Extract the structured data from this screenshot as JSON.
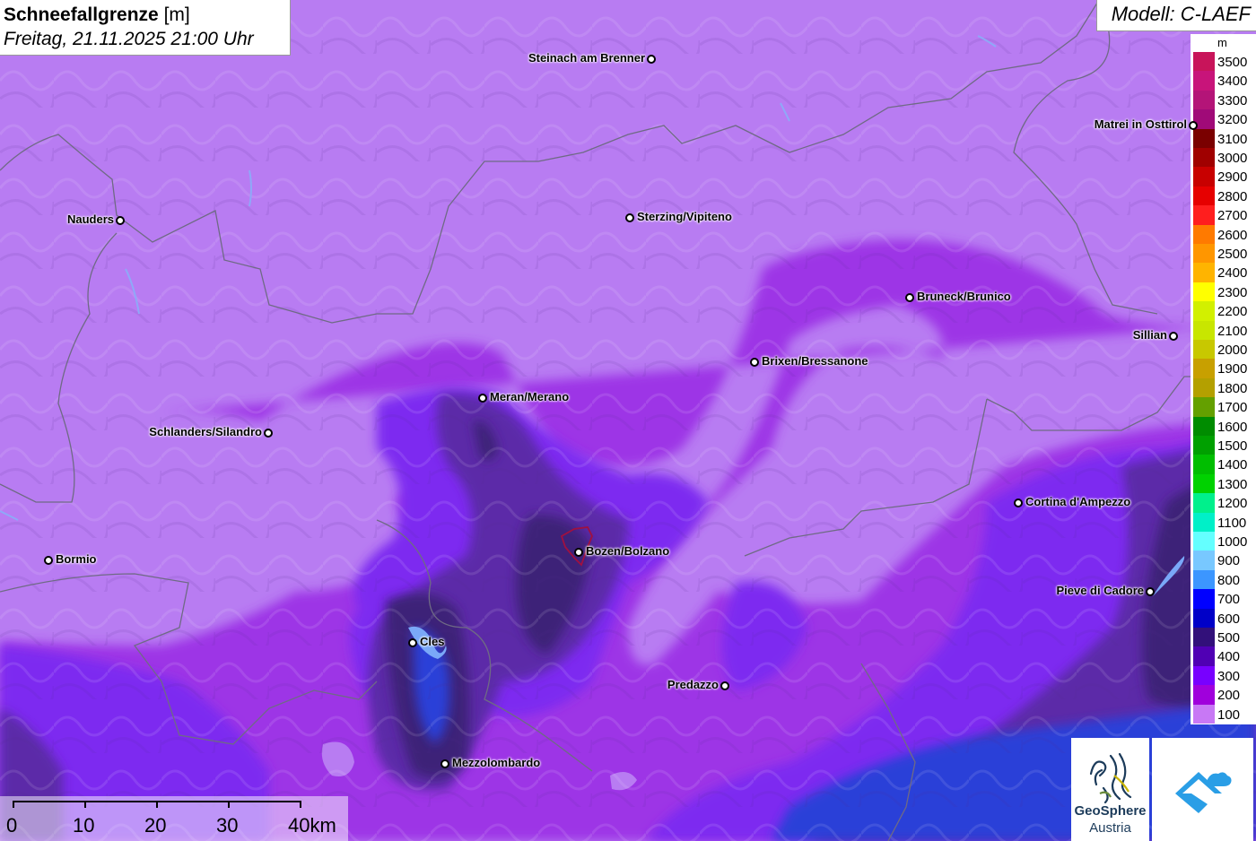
{
  "title": {
    "main_bold": "Schneefallgrenze",
    "main_unit": " [m]",
    "subtitle": "Freitag, 21.11.2025 21:00 Uhr"
  },
  "model_label": "Modell: C-LAEF",
  "legend": {
    "unit": "m",
    "entries": [
      {
        "label": "3500",
        "color": "#c8145a"
      },
      {
        "label": "3400",
        "color": "#c8147a"
      },
      {
        "label": "3300",
        "color": "#b41478"
      },
      {
        "label": "3200",
        "color": "#a00a78"
      },
      {
        "label": "3100",
        "color": "#7a0000"
      },
      {
        "label": "3000",
        "color": "#a00000"
      },
      {
        "label": "2900",
        "color": "#c80000"
      },
      {
        "label": "2800",
        "color": "#e60000"
      },
      {
        "label": "2700",
        "color": "#ff1e1e"
      },
      {
        "label": "2600",
        "color": "#ff7a00"
      },
      {
        "label": "2500",
        "color": "#ff9600"
      },
      {
        "label": "2400",
        "color": "#ffb400"
      },
      {
        "label": "2300",
        "color": "#ffff00"
      },
      {
        "label": "2200",
        "color": "#d2f000"
      },
      {
        "label": "2100",
        "color": "#c8e600"
      },
      {
        "label": "2000",
        "color": "#c8c800"
      },
      {
        "label": "1900",
        "color": "#c8a000"
      },
      {
        "label": "1800",
        "color": "#b4a000"
      },
      {
        "label": "1700",
        "color": "#64a000"
      },
      {
        "label": "1600",
        "color": "#008c00"
      },
      {
        "label": "1500",
        "color": "#00a000"
      },
      {
        "label": "1400",
        "color": "#00be00"
      },
      {
        "label": "1300",
        "color": "#00d200"
      },
      {
        "label": "1200",
        "color": "#00f08c"
      },
      {
        "label": "1100",
        "color": "#00f0c8"
      },
      {
        "label": "1000",
        "color": "#64ffff"
      },
      {
        "label": "900",
        "color": "#78c8ff"
      },
      {
        "label": "800",
        "color": "#3c96ff"
      },
      {
        "label": "700",
        "color": "#0000ff"
      },
      {
        "label": "600",
        "color": "#0000c8"
      },
      {
        "label": "500",
        "color": "#32107a"
      },
      {
        "label": "400",
        "color": "#5000b4"
      },
      {
        "label": "300",
        "color": "#7800ff"
      },
      {
        "label": "200",
        "color": "#a000dc"
      },
      {
        "label": "100",
        "color": "#c878f5"
      }
    ]
  },
  "cities": [
    {
      "name": "Steinach am Brenner",
      "label_side": "left"
    },
    {
      "name": "Matrei in Osttirol",
      "label_side": "left"
    },
    {
      "name": "Nauders",
      "label_side": "left"
    },
    {
      "name": "Sterzing/Vipiteno",
      "label_side": "right"
    },
    {
      "name": "Bruneck/Brunico",
      "label_side": "right"
    },
    {
      "name": "Sillian",
      "label_side": "left"
    },
    {
      "name": "Brixen/Bressanone",
      "label_side": "right"
    },
    {
      "name": "Meran/Merano",
      "label_side": "right"
    },
    {
      "name": "Schlanders/Silandro",
      "label_side": "left"
    },
    {
      "name": "Cortina d'Ampezzo",
      "label_side": "right"
    },
    {
      "name": "Bormio",
      "label_side": "right"
    },
    {
      "name": "Bozen/Bolzano",
      "label_side": "right"
    },
    {
      "name": "Pieve di Cadore",
      "label_side": "left"
    },
    {
      "name": "Cles",
      "label_side": "right"
    },
    {
      "name": "Predazzo",
      "label_side": "left"
    },
    {
      "name": "Mezzolombardo",
      "label_side": "right"
    }
  ],
  "scale": {
    "labels": [
      "0",
      "10",
      "20",
      "30",
      "40km"
    ]
  },
  "logos": {
    "geosphere_line1": "GeoSphere",
    "geosphere_line2": "Austria"
  },
  "colors": {
    "background_100m": "#b87cf2",
    "band_200m": "#9b2ee0",
    "band_300m": "#7a2cf0",
    "band_400m": "#5a2aa8",
    "band_500m": "#3c2478",
    "band_700m": "#2a3ad8",
    "border_line": "#6f6a85"
  }
}
